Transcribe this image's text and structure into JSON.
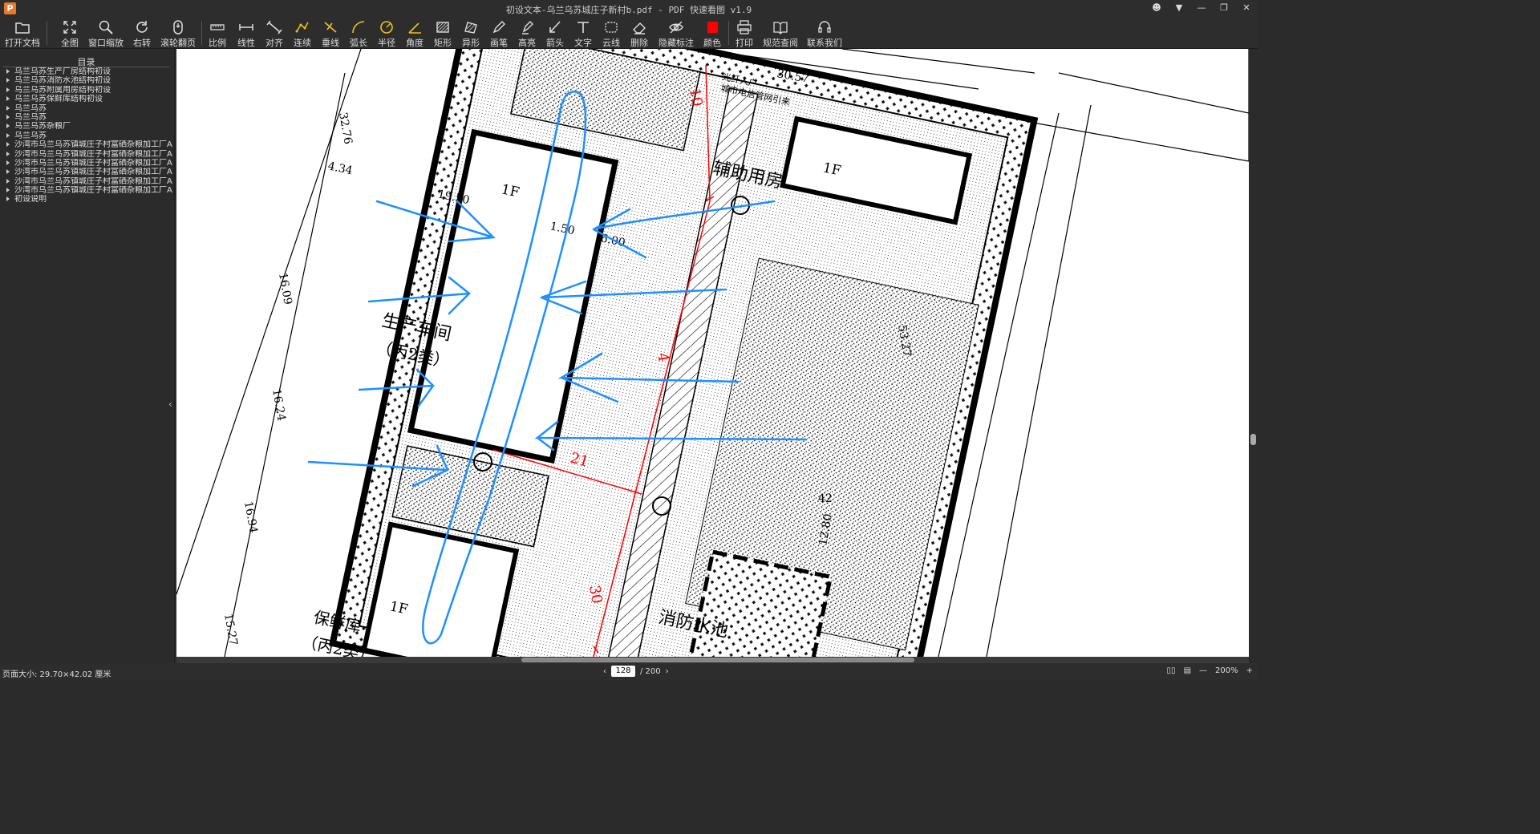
{
  "window": {
    "title": "初设文本-乌兰乌苏城庄子新村b.pdf - PDF 快速看图 v1.9",
    "logo": "P"
  },
  "toolbar": {
    "items": [
      {
        "label": "打开文档",
        "icon": "folder-icon"
      },
      {
        "label": "全图",
        "icon": "fit-all-icon"
      },
      {
        "label": "窗口缩放",
        "icon": "zoom-window-icon"
      },
      {
        "label": "右转",
        "icon": "rotate-right-icon"
      },
      {
        "label": "滚轮翻页",
        "icon": "mouse-wheel-icon"
      },
      {
        "label": "比例",
        "icon": "scale-icon"
      },
      {
        "label": "线性",
        "icon": "linear-measure-icon"
      },
      {
        "label": "对齐",
        "icon": "aligned-measure-icon"
      },
      {
        "label": "连续",
        "icon": "continuous-measure-icon"
      },
      {
        "label": "垂线",
        "icon": "perpendicular-icon"
      },
      {
        "label": "弧长",
        "icon": "arc-length-icon"
      },
      {
        "label": "半径",
        "icon": "radius-icon"
      },
      {
        "label": "角度",
        "icon": "angle-icon"
      },
      {
        "label": "矩形",
        "icon": "rectangle-area-icon"
      },
      {
        "label": "异形",
        "icon": "polygon-area-icon"
      },
      {
        "label": "画笔",
        "icon": "pen-icon"
      },
      {
        "label": "高亮",
        "icon": "highlight-icon"
      },
      {
        "label": "箭头",
        "icon": "arrow-icon"
      },
      {
        "label": "文字",
        "icon": "text-icon"
      },
      {
        "label": "云线",
        "icon": "cloud-line-icon"
      },
      {
        "label": "删除",
        "icon": "eraser-icon"
      },
      {
        "label": "隐藏标注",
        "icon": "eye-icon"
      },
      {
        "label": "颜色",
        "icon": "color-swatch-icon"
      },
      {
        "label": "打印",
        "icon": "printer-icon"
      },
      {
        "label": "规范查阅",
        "icon": "book-icon"
      },
      {
        "label": "联系我们",
        "icon": "headset-icon"
      }
    ],
    "color_swatch": "#ff0000"
  },
  "sidebar": {
    "title": "目录",
    "items": [
      "乌兰乌苏生产厂房结构初设",
      "乌兰乌苏消防水池结构初设",
      "乌兰乌苏附属用房结构初设",
      "乌兰乌苏保鲜库结构初设",
      "乌兰乌苏",
      "乌兰乌苏",
      "乌兰乌苏杂粮厂",
      "乌兰乌苏",
      "沙湾市乌兰乌苏镇城庄子村富硒杂粮加工厂A",
      "沙湾市乌兰乌苏镇城庄子村富硒杂粮加工厂A",
      "沙湾市乌兰乌苏镇城庄子村富硒杂粮加工厂A",
      "沙湾市乌兰乌苏镇城庄子村富硒杂粮加工厂A",
      "沙湾市乌兰乌苏镇城庄子村富硒杂粮加工厂A",
      "沙湾市乌兰乌苏镇城庄子村富硒杂粮加工厂A",
      "初设说明"
    ]
  },
  "drawing": {
    "labels": {
      "aux_room": "辅助用房",
      "aux_floor": "1F",
      "workshop": "生产车间",
      "workshop_class": "（丙2类）",
      "workshop_floor": "1F",
      "cold_storage": "保鲜库",
      "cold_storage_class": "（丙2类）",
      "cold_storage_floor": "1F",
      "fire_pool": "消防水池",
      "fiber_in": "光纤入户",
      "telecom": "城市电信管网引来"
    },
    "dims": {
      "d3057": "30.57",
      "d3276": "32.76",
      "d434": "4.34",
      "d1950": "19.50",
      "d1609": "16.09",
      "d1624": "16.24",
      "d1694": "16.94",
      "d1527": "15.27",
      "d5327": "53.27",
      "d1280": "12.80",
      "d42": "42",
      "d150": "1.50",
      "d600": "6.00",
      "d10": "10",
      "d21": "21",
      "d30": "30",
      "d4": "4"
    },
    "colors": {
      "annotation_blue": "#1e90ff",
      "measure_red": "#ff0000"
    }
  },
  "status": {
    "page_size": "页面大小: 29.70×42.02 厘米",
    "current_page": "128",
    "total_pages": "/ 200",
    "zoom": "200%"
  }
}
